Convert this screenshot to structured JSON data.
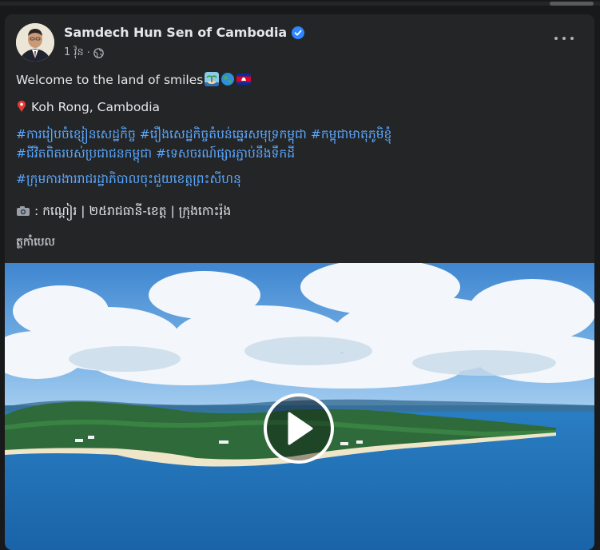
{
  "post": {
    "author": "Samdech Hun Sen of Cambodia",
    "time": "1 វ៉ុន",
    "separator": "·",
    "line1_text": "Welcome to the land of smiles",
    "location": "Koh Rong, Cambodia",
    "hashtags_line1": "#ការរៀបចំខ្សៀនសេដ្ឋកិច្ច #រឿងសេដ្ឋកិច្ចតំបន់ឆ្នេរសមុទ្រកម្ពុជា #កម្ពុជាមាតុភូមិខ្ញុំ",
    "hashtags_line2": "#ជីវិតពិតរបស់ប្រជាជនកម្ពុជា #ទេសចរណ៍ផ្សារភ្ជាប់នឹងទឹកដី",
    "hashtags_line3": "#ក្រុមការងាររាជរដ្ឋាភិបាលចុះជួយខេត្តព្រះសីហនុ",
    "camera_line": ": កណ្តៀរ | ២៥រាជធានី-ខេត្ត | ក្រុងកោះរ៉ុង",
    "see_translation": "ត្ថកាំបេល"
  },
  "icons": {
    "verified": "verified-badge-icon",
    "globe": "globe-icon",
    "more": "more-options-icon",
    "pin": "location-pin-icon",
    "camera": "camera-icon",
    "play": "play-icon"
  },
  "colors": {
    "card_bg": "#242526",
    "page_bg": "#18191a",
    "text": "#e4e6eb",
    "secondary": "#b0b3b8",
    "hashtag": "#5aa7ff",
    "verified": "#2d88ff"
  }
}
